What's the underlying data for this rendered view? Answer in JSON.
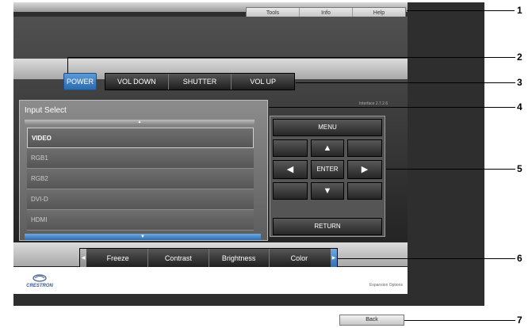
{
  "top_links": [
    "Tools",
    "Info",
    "Help"
  ],
  "controls": {
    "power": "POWER",
    "vol_down": "VOL DOWN",
    "shutter": "SHUTTER",
    "vol_up": "VOL UP"
  },
  "interface_version": "Interface 2.7.2.6",
  "input_select": {
    "title": "Input Select",
    "items": [
      "VIDEO",
      "RGB1",
      "RGB2",
      "DVI-D",
      "HDMI"
    ],
    "selected": "VIDEO"
  },
  "nav": {
    "menu": "MENU",
    "enter": "ENTER",
    "return": "RETURN",
    "up_glyph": "▲",
    "down_glyph": "▼",
    "left_glyph": "◀",
    "right_glyph": "▶"
  },
  "functions": [
    "Freeze",
    "Contrast",
    "Brightness",
    "Color"
  ],
  "footer": {
    "logo_text": "CRESTRON",
    "expansion_options": "Expansion Options"
  },
  "back_button": "Back",
  "callouts": [
    "1",
    "2",
    "3",
    "4",
    "5",
    "6",
    "7"
  ],
  "colors": {
    "accent_blue": "#2a6bb0",
    "panel_dark": "#2e2e2e"
  }
}
